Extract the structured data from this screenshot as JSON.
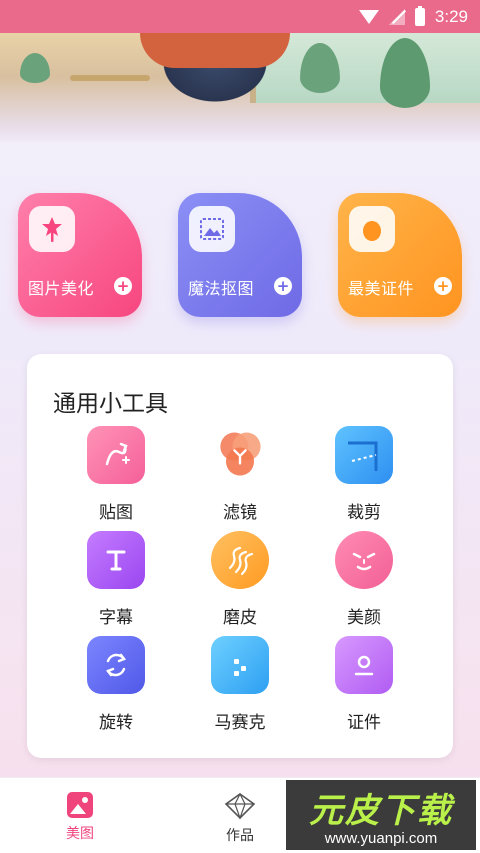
{
  "status_bar": {
    "time": "3:29"
  },
  "feature_cards": [
    {
      "label": "图片美化",
      "plus": "+"
    },
    {
      "label": "魔法抠图",
      "plus": "+"
    },
    {
      "label": "最美证件",
      "plus": "+"
    }
  ],
  "tools": {
    "title": "通用小工具",
    "items": [
      {
        "label": "贴图"
      },
      {
        "label": "滤镜"
      },
      {
        "label": "裁剪"
      },
      {
        "label": "字幕"
      },
      {
        "label": "磨皮"
      },
      {
        "label": "美颜"
      },
      {
        "label": "旋转"
      },
      {
        "label": "马赛克"
      },
      {
        "label": "证件"
      }
    ]
  },
  "bottom_nav": [
    {
      "label": "美图",
      "active": true
    },
    {
      "label": "作品",
      "active": false
    }
  ],
  "watermark": {
    "logo": "元皮下载",
    "url": "www.yuanpi.com"
  },
  "colors": {
    "status_bar": "#ea6a8c",
    "pink": "#f7467f",
    "purple": "#6f6ae6",
    "orange": "#ff9420",
    "nav_active": "#f0447d"
  }
}
